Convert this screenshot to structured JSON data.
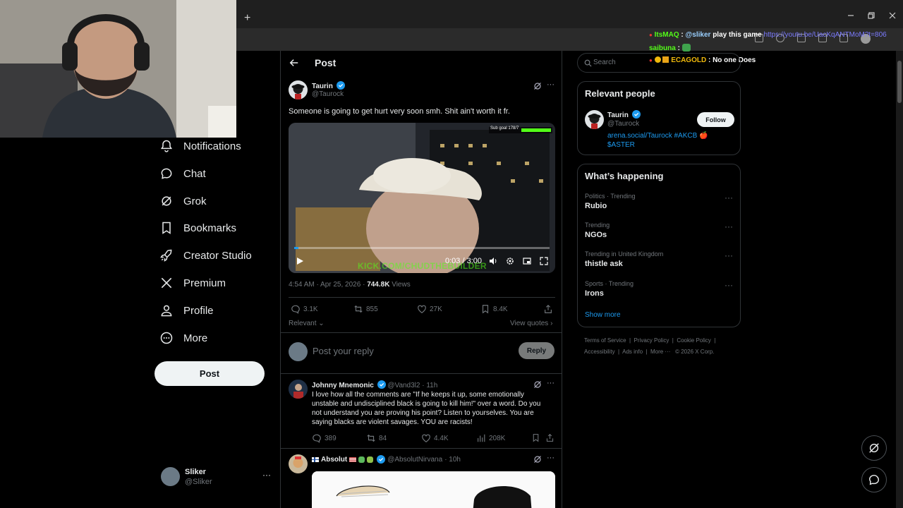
{
  "chat": [
    {
      "user": "ItsMAQ",
      "user_color": "#53fc18",
      "message_mention": "@sliker",
      "message_text": "play this game",
      "message_link": "https://youtu.be/UacKqANTMoM?t=806"
    },
    {
      "user": "saibuna",
      "user_color": "#53fc18",
      "message_text": ""
    },
    {
      "user": "ECAGOLD",
      "user_color": "#f0b90b",
      "message_text": "No one Does"
    }
  ],
  "nav": {
    "items": [
      {
        "label": "Notifications",
        "icon": "bell-icon"
      },
      {
        "label": "Chat",
        "icon": "chat-icon"
      },
      {
        "label": "Grok",
        "icon": "grok-icon"
      },
      {
        "label": "Bookmarks",
        "icon": "bookmark-icon"
      },
      {
        "label": "Creator Studio",
        "icon": "rocket-icon"
      },
      {
        "label": "Premium",
        "icon": "x-logo-icon"
      },
      {
        "label": "Profile",
        "icon": "person-icon"
      },
      {
        "label": "More",
        "icon": "more-circle-icon"
      }
    ],
    "post_label": "Post"
  },
  "account": {
    "name": "Sliker",
    "handle": "@Sliker"
  },
  "header": {
    "title": "Post"
  },
  "tweet": {
    "name": "Taurin",
    "handle": "@Taurock",
    "text": "Someone is going to get hurt very soon smh. Shit ain't worth it fr.",
    "video": {
      "overlay": "Sub goal 178/7",
      "time": "0:03 / 3:00",
      "watermark": "KICK.COM/CHUDTHEBUILDER",
      "progress": 0.017
    },
    "timestamp": "4:54 AM · Apr 25, 2026 · ",
    "views": "744.8K",
    "views_label": " Views",
    "replies": "3.1K",
    "reposts": "855",
    "likes": "27K",
    "bookmarks": "8.4K",
    "sort": "Relevant",
    "view_quotes": "View quotes"
  },
  "reply_box": {
    "placeholder": "Post your reply",
    "button": "Reply"
  },
  "replies": [
    {
      "name": "Johnny Mnemonic",
      "handle": "@Vand3l2",
      "time": "· 11h",
      "text": "I love how all the comments are \"If he keeps it up, some emotionally unstable and undisciplined black is going to kill him!\" over a word. Do you not understand you are proving his point? Listen to yourselves. You are saying blacks are violent savages. YOU are racists!",
      "replies": "389",
      "reposts": "84",
      "likes": "4.4K",
      "views": "208K"
    },
    {
      "name": "Absolut",
      "handle": "@AbsolutNirvana",
      "time": "· 10h"
    }
  ],
  "search": {
    "placeholder": "Search"
  },
  "relevant": {
    "title": "Relevant people",
    "name": "Taurin",
    "handle": "@Taurock",
    "follow": "Follow",
    "bio": "arena.social/Taurock #AKCB 🍎 $ASTER"
  },
  "happening": {
    "title": "What’s happening",
    "trends": [
      {
        "meta": "Politics · Trending",
        "name": "Rubio"
      },
      {
        "meta": "Trending",
        "name": "NGOs"
      },
      {
        "meta": "Trending in United Kingdom",
        "name": "thistle ask"
      },
      {
        "meta": "Sports · Trending",
        "name": "Irons"
      }
    ],
    "show_more": "Show more"
  },
  "footer": {
    "links": [
      "Terms of Service",
      "Privacy Policy",
      "Cookie Policy",
      "Accessibility",
      "Ads info",
      "More ···",
      "© 2026 X Corp."
    ]
  },
  "colors": {
    "accent": "#1d9bf0",
    "background": "#000000",
    "border": "#2f3336"
  }
}
